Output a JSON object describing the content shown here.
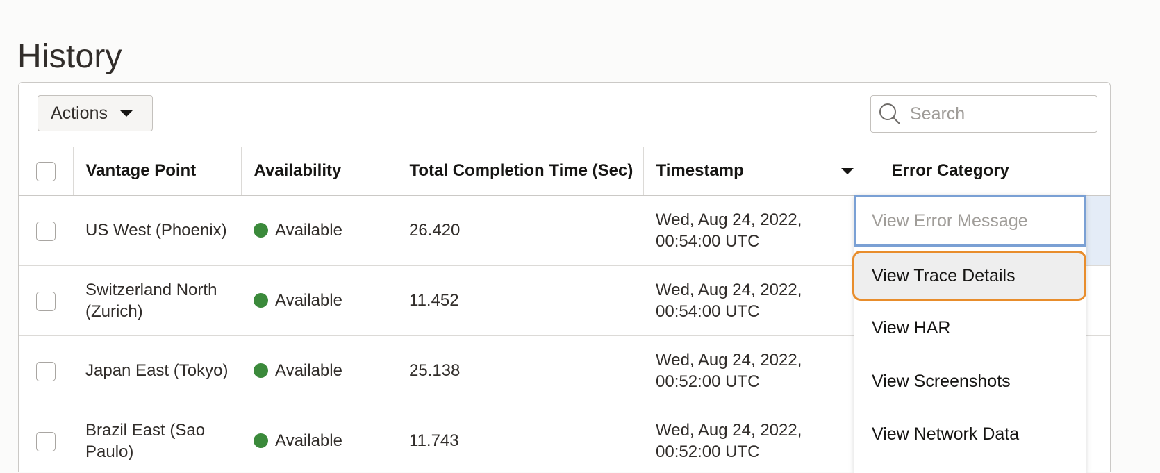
{
  "page": {
    "title": "History"
  },
  "toolbar": {
    "actions_label": "Actions",
    "search_placeholder": "Search"
  },
  "table": {
    "columns": [
      "Vantage Point",
      "Availability",
      "Total Completion Time (Sec)",
      "Timestamp",
      "Error Category"
    ],
    "rows": [
      {
        "vantage_point": "US West (Phoenix)",
        "availability": "Available",
        "time": "26.420",
        "timestamp": "Wed, Aug 24, 2022, 00:54:00 UTC"
      },
      {
        "vantage_point": "Switzerland North (Zurich)",
        "availability": "Available",
        "time": "11.452",
        "timestamp": "Wed, Aug 24, 2022, 00:54:00 UTC"
      },
      {
        "vantage_point": "Japan East (Tokyo)",
        "availability": "Available",
        "time": "25.138",
        "timestamp": "Wed, Aug 24, 2022, 00:52:00 UTC"
      },
      {
        "vantage_point": "Brazil East (Sao Paulo)",
        "availability": "Available",
        "time": "11.743",
        "timestamp": "Wed, Aug 24, 2022, 00:52:00 UTC"
      }
    ]
  },
  "context_menu": {
    "items": [
      "View Error Message",
      "View Trace Details",
      "View HAR",
      "View Screenshots",
      "View Network Data"
    ]
  },
  "colors": {
    "available": "#3b8a3b",
    "focus_ring": "#e88d2c",
    "selection": "#e4ecf7"
  }
}
